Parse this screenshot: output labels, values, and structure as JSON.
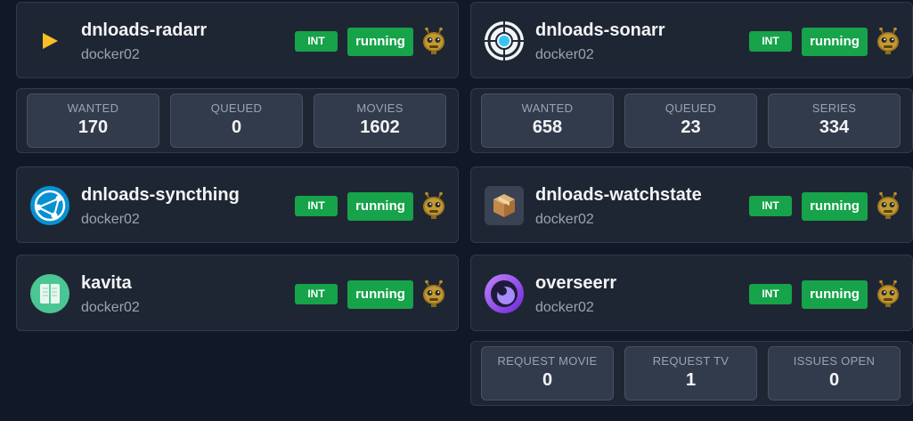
{
  "services": {
    "radarr": {
      "name": "dnloads-radarr",
      "host": "docker02",
      "int_label": "INT",
      "status": "running",
      "stats": [
        {
          "label": "WANTED",
          "value": "170"
        },
        {
          "label": "QUEUED",
          "value": "0"
        },
        {
          "label": "MOVIES",
          "value": "1602"
        }
      ]
    },
    "sonarr": {
      "name": "dnloads-sonarr",
      "host": "docker02",
      "int_label": "INT",
      "status": "running",
      "stats": [
        {
          "label": "WANTED",
          "value": "658"
        },
        {
          "label": "QUEUED",
          "value": "23"
        },
        {
          "label": "SERIES",
          "value": "334"
        }
      ]
    },
    "syncthing": {
      "name": "dnloads-syncthing",
      "host": "docker02",
      "int_label": "INT",
      "status": "running"
    },
    "watchstate": {
      "name": "dnloads-watchstate",
      "host": "docker02",
      "int_label": "INT",
      "status": "running"
    },
    "kavita": {
      "name": "kavita",
      "host": "docker02",
      "int_label": "INT",
      "status": "running"
    },
    "overseerr": {
      "name": "overseerr",
      "host": "docker02",
      "int_label": "INT",
      "status": "running",
      "stats": [
        {
          "label": "REQUEST MOVIE",
          "value": "0"
        },
        {
          "label": "REQUEST TV",
          "value": "1"
        },
        {
          "label": "ISSUES OPEN",
          "value": "0"
        }
      ]
    }
  },
  "colors": {
    "background": "#111827",
    "card": "#1f2633",
    "stat_tile": "#323b4b",
    "status_green": "#16a34a",
    "radarr_accent": "#fbbf24",
    "syncthing_accent": "#0891d1",
    "kavita_accent": "#4ac694",
    "overseerr_accent": "#8b5cf6"
  },
  "icons": {
    "radarr": "play-triangle-icon",
    "sonarr": "sonarr-ring-icon",
    "syncthing": "syncthing-network-icon",
    "watchstate": "package-box-icon",
    "kavita": "open-book-icon",
    "overseerr": "overseerr-eye-icon",
    "docker_status": "robot-bot-icon"
  }
}
